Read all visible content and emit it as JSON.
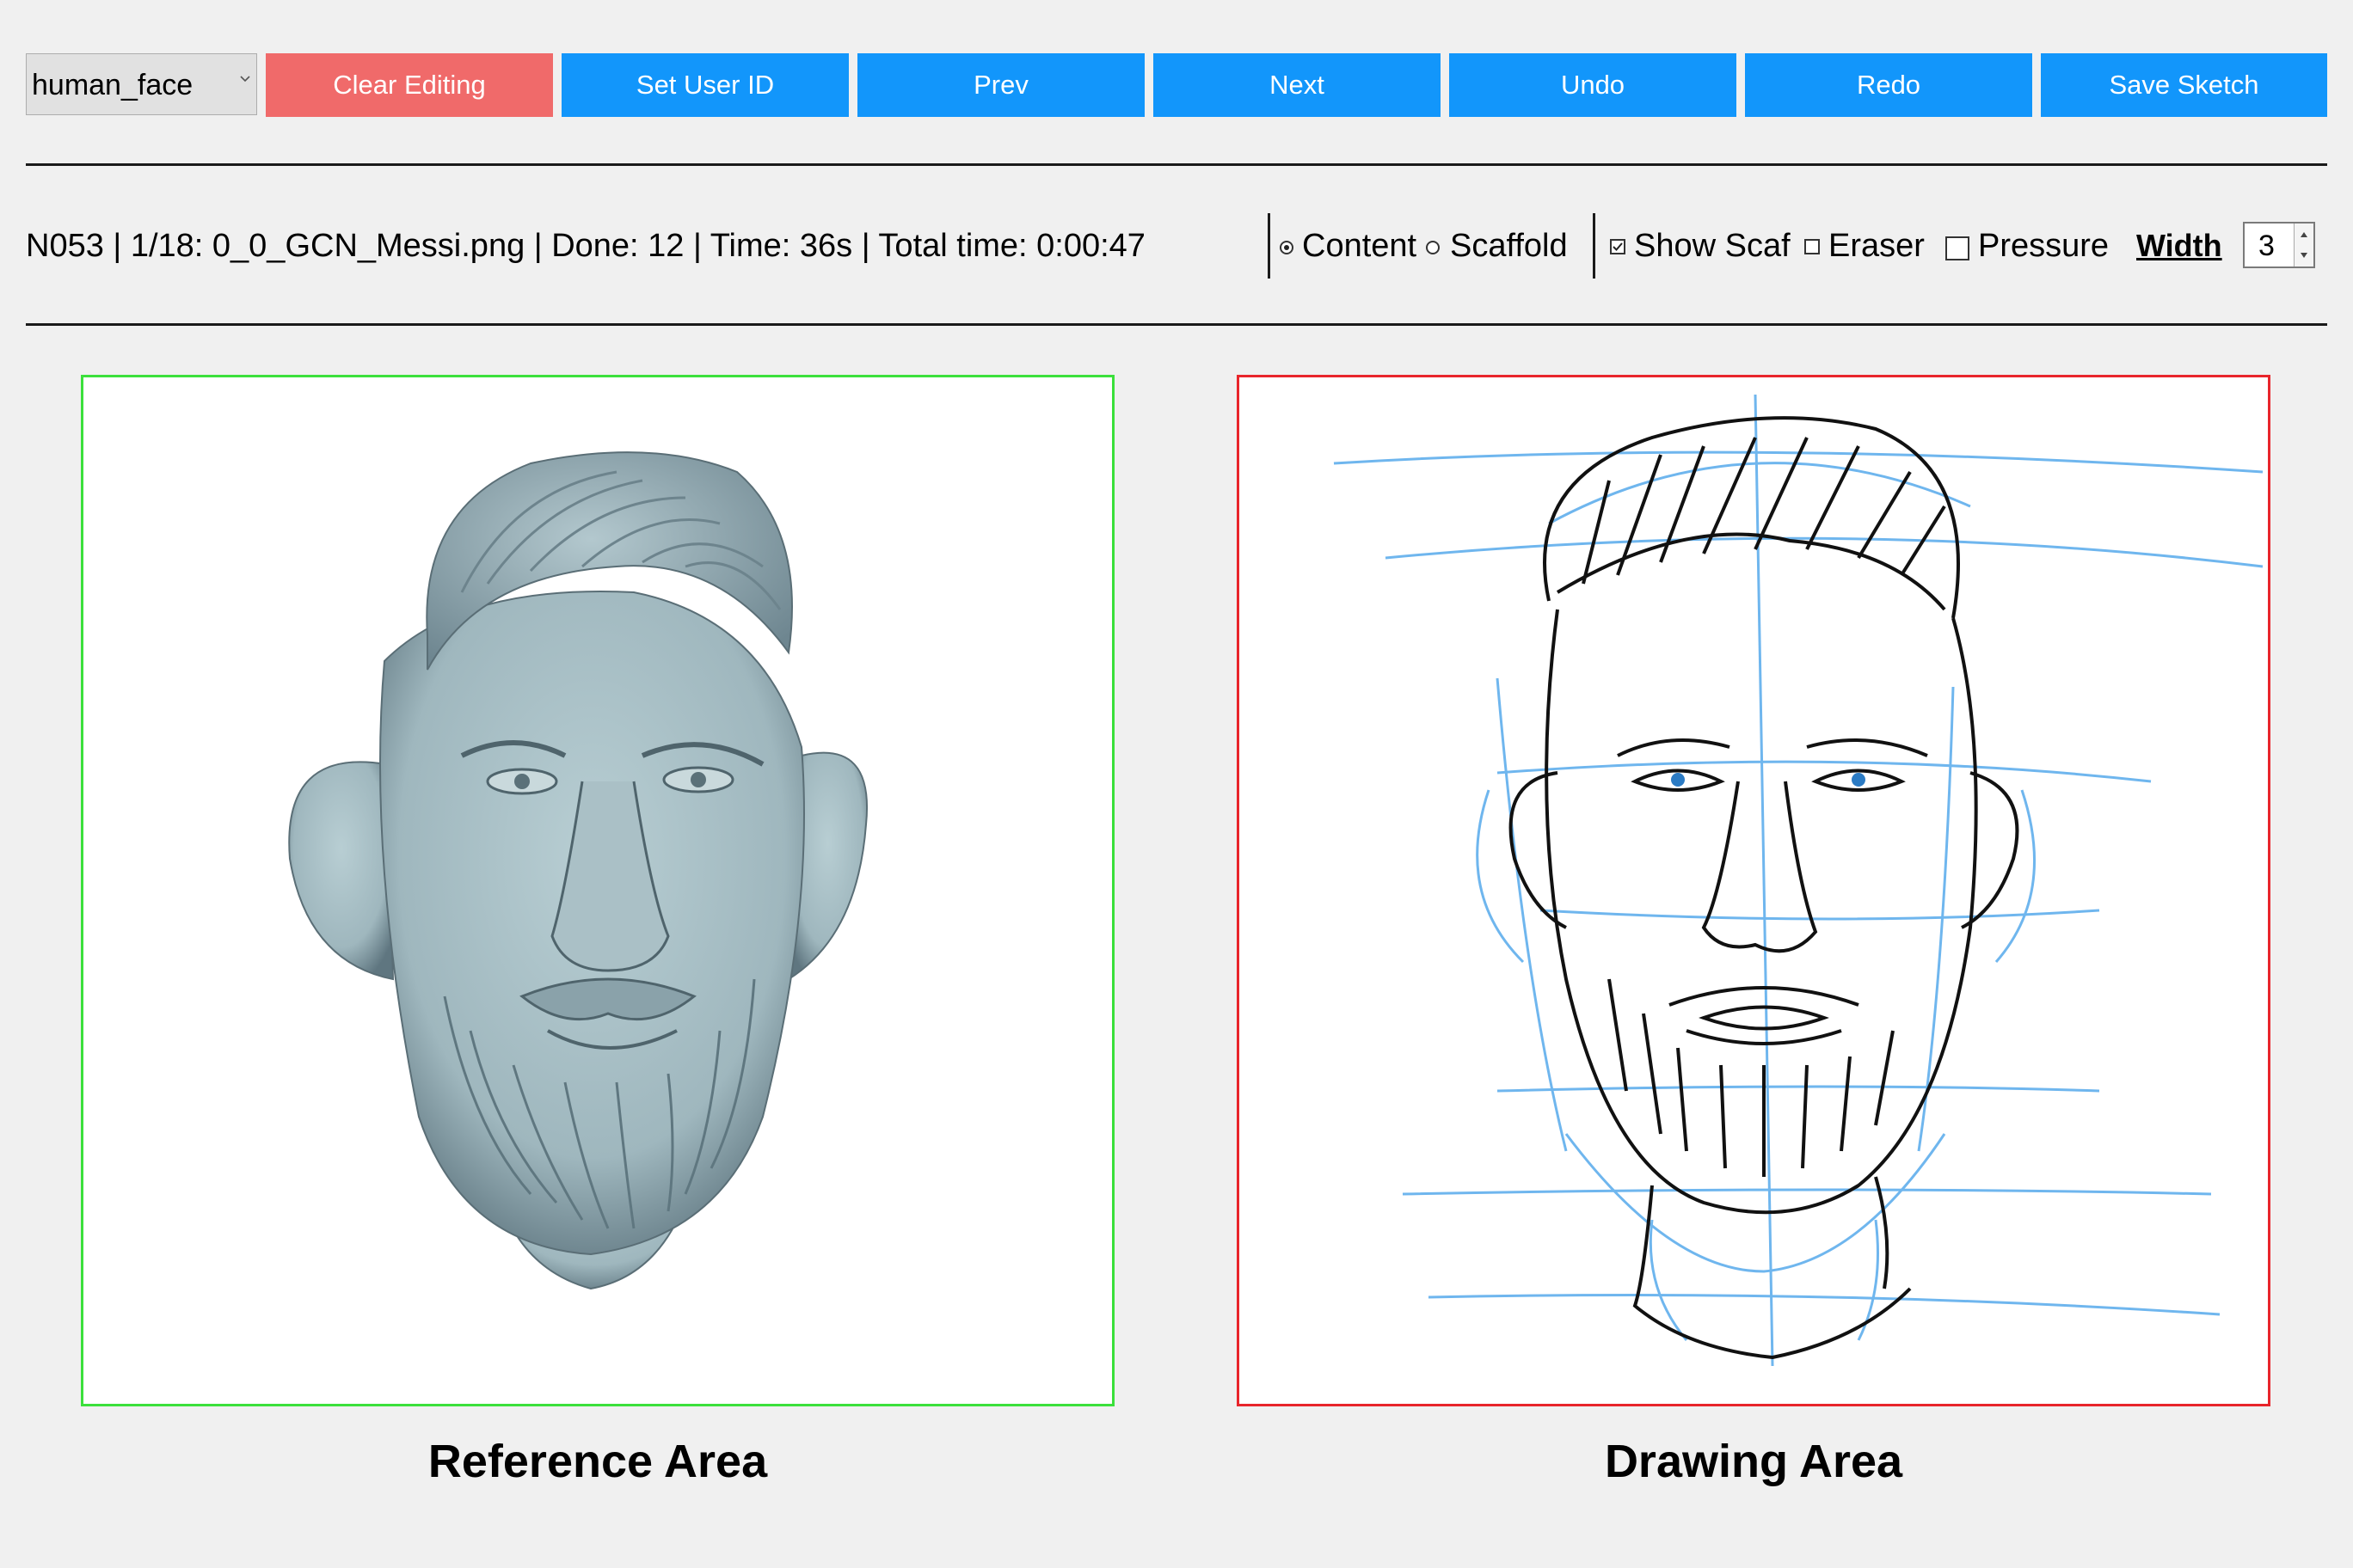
{
  "toolbar": {
    "category_select": {
      "value": "human_face"
    },
    "buttons": {
      "clear_editing": "Clear Editing",
      "set_user_id": "Set User ID",
      "prev": "Prev",
      "next": "Next",
      "undo": "Undo",
      "redo": "Redo",
      "save_sketch": "Save Sketch"
    },
    "colors": {
      "danger": "#f06a6a",
      "primary": "#1296fb"
    }
  },
  "status": {
    "text": "N053 | 1/18: 0_0_GCN_Messi.png | Done: 12 | Time: 36s | Total time: 0:00:47"
  },
  "mode": {
    "content_label": "Content",
    "scaffold_label": "Scaffold",
    "selected": "Content"
  },
  "options": {
    "show_scaf": {
      "label": "Show Scaf",
      "checked": true
    },
    "eraser": {
      "label": "Eraser",
      "checked": false
    },
    "pressure": {
      "label": "Pressure",
      "checked": false
    }
  },
  "width": {
    "label": "Width",
    "value": "3"
  },
  "areas": {
    "reference_label": "Reference Area",
    "drawing_label": "Drawing Area",
    "reference_border": "#3be03b",
    "drawing_border": "#e8252b",
    "scaffold_stroke": "#6fb6ee",
    "content_stroke": "#111111"
  }
}
